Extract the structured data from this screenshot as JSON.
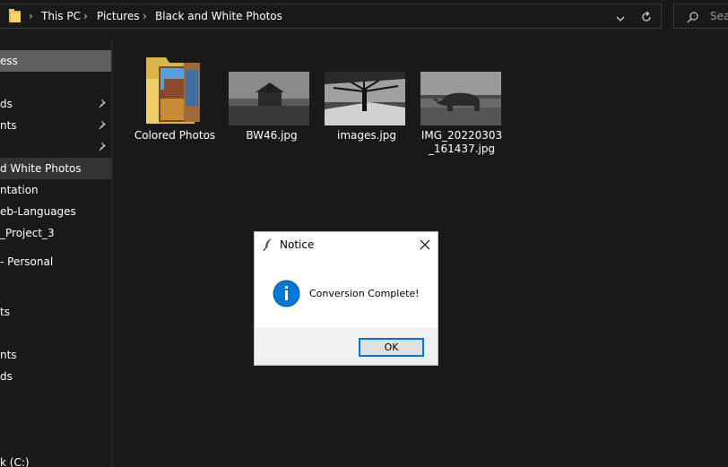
{
  "address_bar": {
    "breadcrumbs": [
      "This PC",
      "Pictures",
      "Black and White Photos"
    ],
    "folder_icon": "folder-icon",
    "dropdown_icon": "chevron-down-icon",
    "refresh_icon": "refresh-icon"
  },
  "search": {
    "placeholder": "Search"
  },
  "nav": {
    "items": [
      {
        "label": "ess",
        "pinned": false
      },
      {
        "label": "ds",
        "pinned": true
      },
      {
        "label": "nts",
        "pinned": true
      },
      {
        "label": "",
        "pinned": true
      },
      {
        "label": "d White Photos",
        "pinned": false
      },
      {
        "label": "ntation",
        "pinned": false
      },
      {
        "label": "eb-Languages",
        "pinned": false
      },
      {
        "label": "_Project_3",
        "pinned": false
      },
      {
        "label": "- Personal",
        "pinned": false
      },
      {
        "label": "ts",
        "pinned": false
      },
      {
        "label": "nts",
        "pinned": false
      },
      {
        "label": "ds",
        "pinned": false
      },
      {
        "label": "k (C:)",
        "pinned": false
      }
    ]
  },
  "files": [
    {
      "name": "Colored Photos",
      "type": "folder"
    },
    {
      "name": "BW46.jpg",
      "type": "image"
    },
    {
      "name": "images.jpg",
      "type": "image"
    },
    {
      "name": "IMG_20220303_161437.jpg",
      "type": "image"
    }
  ],
  "dialog": {
    "title": "Notice",
    "message": "Conversion Complete!",
    "ok_label": "OK",
    "icon": "info-icon"
  },
  "colors": {
    "background": "#191919",
    "selected_nav": "#5f5f5f",
    "accent": "#0078d7"
  }
}
